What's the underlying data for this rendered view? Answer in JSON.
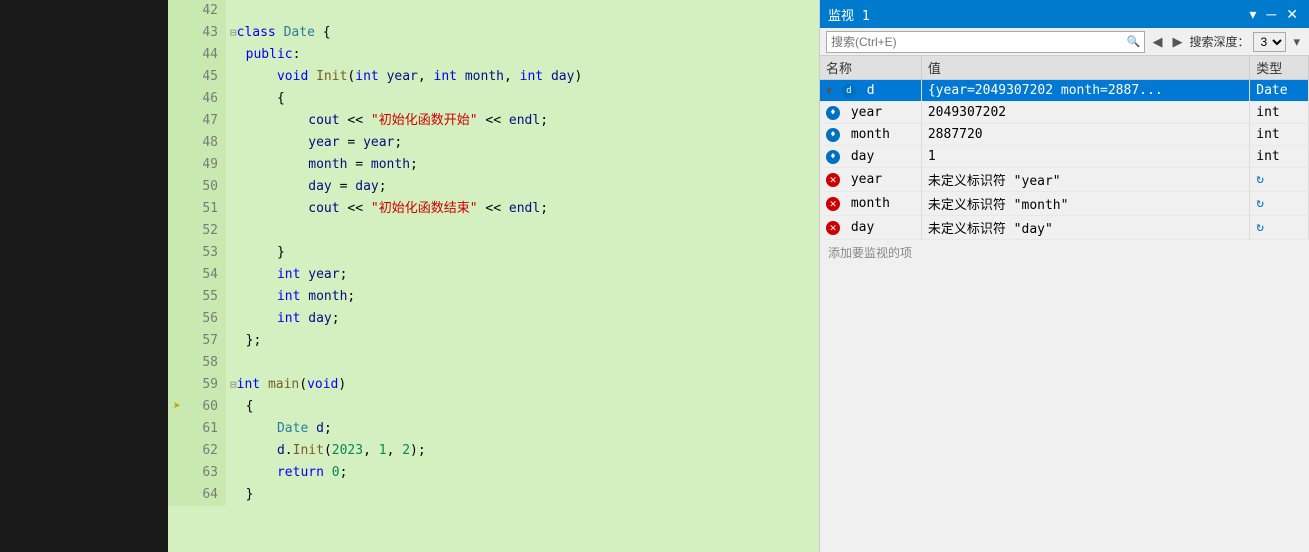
{
  "sidebar": {
    "bg": "#1a1a1a"
  },
  "editor": {
    "lines": [
      {
        "num": 42,
        "content": "",
        "arrow": false,
        "highlight": false
      },
      {
        "num": 43,
        "content": "=class Date {",
        "arrow": false,
        "highlight": false
      },
      {
        "num": 44,
        "content": "  public:",
        "arrow": false,
        "highlight": false
      },
      {
        "num": 45,
        "content": "      void Init(int year, int month, int day)",
        "arrow": false,
        "highlight": false
      },
      {
        "num": 46,
        "content": "      {",
        "arrow": false,
        "highlight": false
      },
      {
        "num": 47,
        "content": "          cout << \"初始化函数开始\" << endl;",
        "arrow": false,
        "highlight": false
      },
      {
        "num": 48,
        "content": "          year = year;",
        "arrow": false,
        "highlight": false
      },
      {
        "num": 49,
        "content": "          month = month;",
        "arrow": false,
        "highlight": false
      },
      {
        "num": 50,
        "content": "          day = day;",
        "arrow": false,
        "highlight": false
      },
      {
        "num": 51,
        "content": "          cout << \"初始化函数结束\" << endl;",
        "arrow": false,
        "highlight": false
      },
      {
        "num": 52,
        "content": "",
        "arrow": false,
        "highlight": false
      },
      {
        "num": 53,
        "content": "      }",
        "arrow": false,
        "highlight": false
      },
      {
        "num": 54,
        "content": "      int year;",
        "arrow": false,
        "highlight": false
      },
      {
        "num": 55,
        "content": "      int month;",
        "arrow": false,
        "highlight": false
      },
      {
        "num": 56,
        "content": "      int day;",
        "arrow": false,
        "highlight": false
      },
      {
        "num": 57,
        "content": "  };",
        "arrow": false,
        "highlight": false
      },
      {
        "num": 58,
        "content": "",
        "arrow": false,
        "highlight": false
      },
      {
        "num": 59,
        "content": "=int main(void)",
        "arrow": false,
        "highlight": false
      },
      {
        "num": 60,
        "content": "  {",
        "arrow": true,
        "highlight": false
      },
      {
        "num": 61,
        "content": "      Date d;",
        "arrow": false,
        "highlight": false
      },
      {
        "num": 62,
        "content": "      d.Init(2023, 1, 2);",
        "arrow": false,
        "highlight": false
      },
      {
        "num": 63,
        "content": "      return 0;",
        "arrow": false,
        "highlight": false
      },
      {
        "num": 64,
        "content": "  }",
        "arrow": false,
        "highlight": false
      }
    ]
  },
  "watch": {
    "title": "监视 1",
    "search_placeholder": "搜索(Ctrl+E)",
    "depth_label": "搜索深度：",
    "depth_value": "3",
    "columns": [
      "名称",
      "值",
      "类型"
    ],
    "rows": [
      {
        "id": "d",
        "name": "d",
        "value": "{year=2049307202 month=2887...",
        "type": "Date",
        "level": 0,
        "icon": "blue",
        "expanded": true,
        "selected": true,
        "prefix": "◀ "
      },
      {
        "id": "d.year",
        "name": "year",
        "value": "2049307202",
        "type": "int",
        "level": 1,
        "icon": "blue",
        "selected": false
      },
      {
        "id": "d.month",
        "name": "month",
        "value": "2887720",
        "type": "int",
        "level": 1,
        "icon": "blue",
        "selected": false
      },
      {
        "id": "d.day",
        "name": "day",
        "value": "1",
        "type": "int",
        "level": 1,
        "icon": "blue",
        "selected": false
      },
      {
        "id": "year",
        "name": "year",
        "value": "未定义标识符 \"year\"",
        "type": "",
        "level": 0,
        "icon": "red",
        "selected": false,
        "refresh": true
      },
      {
        "id": "month",
        "name": "month",
        "value": "未定义标识符 \"month\"",
        "type": "",
        "level": 0,
        "icon": "red",
        "selected": false,
        "refresh": true
      },
      {
        "id": "day",
        "name": "day",
        "value": "未定义标识符 \"day\"",
        "type": "",
        "level": 0,
        "icon": "red",
        "selected": false,
        "refresh": true
      }
    ],
    "add_label": "添加要监视的项"
  }
}
